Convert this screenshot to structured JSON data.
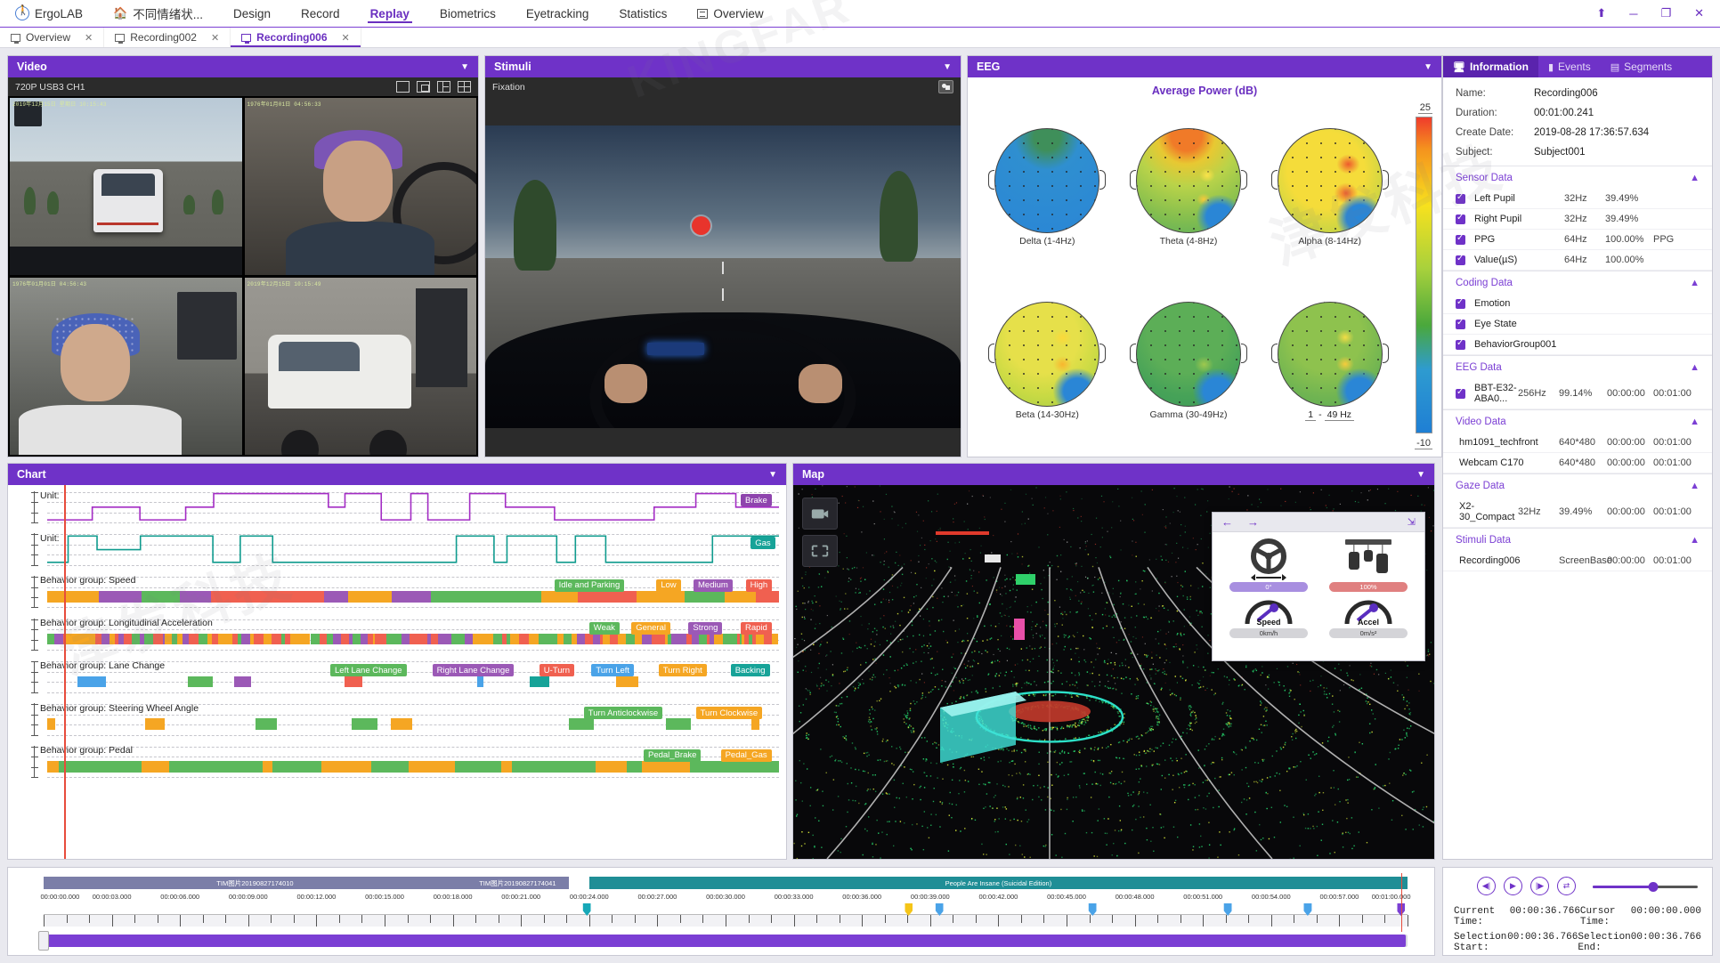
{
  "app": {
    "name": "ErgoLAB",
    "menu": [
      {
        "label": "ErgoLAB",
        "icon": "ergolab-logo"
      },
      {
        "label": "不同情绪状...",
        "icon": "home-icon"
      },
      {
        "label": "Design",
        "icon": ""
      },
      {
        "label": "Record",
        "icon": ""
      },
      {
        "label": "Replay",
        "icon": "",
        "active": true
      },
      {
        "label": "Biometrics",
        "icon": ""
      },
      {
        "label": "Eyetracking",
        "icon": ""
      },
      {
        "label": "Statistics",
        "icon": ""
      },
      {
        "label": "Overview",
        "icon": "overview-icon"
      }
    ],
    "window_controls": [
      "pin",
      "minimize",
      "restore",
      "close"
    ]
  },
  "tabs": [
    {
      "label": "Overview",
      "active": false
    },
    {
      "label": "Recording002",
      "active": false
    },
    {
      "label": "Recording006",
      "active": true
    }
  ],
  "video": {
    "title": "Video",
    "source_label": "720P USB3 CH1",
    "layout_buttons": [
      "single-view",
      "pip-view",
      "split-view",
      "grid-view"
    ],
    "cells": [
      {
        "stamp": "2019年12月15日 星期日 10:15:43"
      },
      {
        "stamp": "1976年01月01日 04:56:33"
      },
      {
        "stamp": "1976年01月01日 04:56:43"
      },
      {
        "stamp": "2019年12月15日 10:15:49"
      }
    ]
  },
  "stimuli": {
    "title": "Stimuli",
    "sub_label": "Fixation",
    "snapshot_button": "snapshot-icon"
  },
  "eeg": {
    "title": "EEG",
    "chart_title": "Average Power (dB)",
    "colorbar_max": "25",
    "colorbar_min": "-10",
    "band_low": "1",
    "band_dash": "-",
    "band_high": "49 Hz",
    "bands": [
      {
        "label": "Delta (1-4Hz)"
      },
      {
        "label": "Theta (4-8Hz)"
      },
      {
        "label": "Alpha (8-14Hz)"
      },
      {
        "label": "Beta (14-30Hz)"
      },
      {
        "label": "Gamma (30-49Hz)"
      }
    ]
  },
  "info": {
    "tabs": [
      {
        "label": "Information",
        "icon": "monitor-icon",
        "active": true
      },
      {
        "label": "Events",
        "icon": "event-icon",
        "active": false
      },
      {
        "label": "Segments",
        "icon": "segments-icon",
        "active": false
      }
    ],
    "fields": [
      {
        "key": "Name:",
        "value": "Recording006"
      },
      {
        "key": "Duration:",
        "value": "00:01:00.241"
      },
      {
        "key": "Create Date:",
        "value": "2019-08-28 17:36:57.634"
      },
      {
        "key": "Subject:",
        "value": "Subject001"
      }
    ],
    "sections": [
      {
        "title": "Sensor Data",
        "rows": [
          {
            "checked": true,
            "name": "Left Pupil",
            "c1": "32Hz",
            "c2": "39.49%",
            "c3": ""
          },
          {
            "checked": true,
            "name": "Right Pupil",
            "c1": "32Hz",
            "c2": "39.49%",
            "c3": ""
          },
          {
            "checked": true,
            "name": "PPG",
            "c1": "64Hz",
            "c2": "100.00%",
            "c3": "PPG"
          },
          {
            "checked": true,
            "name": "Value(µS)",
            "c1": "64Hz",
            "c2": "100.00%",
            "c3": ""
          }
        ]
      },
      {
        "title": "Coding Data",
        "rows": [
          {
            "checked": true,
            "name": "Emotion",
            "c1": "",
            "c2": "",
            "c3": ""
          },
          {
            "checked": true,
            "name": "Eye State",
            "c1": "",
            "c2": "",
            "c3": ""
          },
          {
            "checked": true,
            "name": "BehaviorGroup001",
            "c1": "",
            "c2": "",
            "c3": ""
          }
        ]
      },
      {
        "title": "EEG Data",
        "rows": [
          {
            "checked": true,
            "name": "BBT-E32-ABA0...",
            "c1": "256Hz",
            "c2": "99.14%",
            "c3": "00:00:00",
            "c4": "00:01:00"
          }
        ]
      },
      {
        "title": "Video Data",
        "rows": [
          {
            "checked": null,
            "name": "hm1091_techfront",
            "c1": "640*480",
            "c2": "",
            "c3": "00:00:00",
            "c4": "00:01:00"
          },
          {
            "checked": null,
            "name": "Webcam C170",
            "c1": "640*480",
            "c2": "",
            "c3": "00:00:00",
            "c4": "00:01:00"
          }
        ]
      },
      {
        "title": "Gaze Data",
        "rows": [
          {
            "checked": null,
            "name": "X2-30_Compact",
            "c1": "32Hz",
            "c2": "39.49%",
            "c3": "00:00:00",
            "c4": "00:01:00"
          }
        ]
      },
      {
        "title": "Stimuli Data",
        "rows": [
          {
            "checked": null,
            "name": "Recording006",
            "c1": "ScreenBase",
            "c2": "",
            "c3": "00:00:00",
            "c4": "00:01:00"
          }
        ]
      }
    ]
  },
  "chart": {
    "title": "Chart",
    "rows": [
      {
        "label": "Unit:",
        "type": "line",
        "color": "#a32cc4",
        "tags": [
          {
            "text": "Brake",
            "color": "#8e44ad"
          }
        ]
      },
      {
        "label": "Unit:",
        "type": "line",
        "color": "#0f9b8e",
        "tags": [
          {
            "text": "Gas",
            "color": "#17a398"
          }
        ]
      },
      {
        "label": "Behavior group: Speed",
        "type": "band",
        "tags": [
          {
            "text": "Idle and Parking",
            "color": "#5cb85c"
          },
          {
            "text": "Low",
            "color": "#f5a623"
          },
          {
            "text": "Medium",
            "color": "#9b59b6"
          },
          {
            "text": "High",
            "color": "#f06050"
          }
        ]
      },
      {
        "label": "Behavior group: Longitudinal Acceleration",
        "type": "band",
        "tags": [
          {
            "text": "Weak",
            "color": "#5cb85c"
          },
          {
            "text": "General",
            "color": "#f5a623"
          },
          {
            "text": "Strong",
            "color": "#9b59b6"
          },
          {
            "text": "Rapid",
            "color": "#f06050"
          }
        ]
      },
      {
        "label": "Behavior group: Lane Change",
        "type": "band",
        "tags": [
          {
            "text": "Left Lane Change",
            "color": "#5cb85c"
          },
          {
            "text": "Right Lane Change",
            "color": "#9b59b6"
          },
          {
            "text": "U-Turn",
            "color": "#f06050"
          },
          {
            "text": "Turn Left",
            "color": "#4aa3e8"
          },
          {
            "text": "Turn Right",
            "color": "#f5a623"
          },
          {
            "text": "Backing",
            "color": "#17a398"
          }
        ]
      },
      {
        "label": "Behavior group: Steering Wheel Angle",
        "type": "band",
        "tags": [
          {
            "text": "Turn Anticlockwise",
            "color": "#5cb85c"
          },
          {
            "text": "Turn Clockwise",
            "color": "#f5a623"
          }
        ]
      },
      {
        "label": "Behavior group: Pedal",
        "type": "band",
        "tags": [
          {
            "text": "Pedal_Brake",
            "color": "#5cb85c"
          },
          {
            "text": "Pedal_Gas",
            "color": "#f5a623"
          }
        ]
      }
    ]
  },
  "map": {
    "title": "Map",
    "tools": [
      "camera-icon",
      "fit-icon"
    ],
    "overlay": {
      "back_icon": "arrow-left-icon",
      "forward_icon": "arrow-right-icon",
      "expand_icon": "expand-icon",
      "steering": {
        "icon": "steering-wheel-icon",
        "value": "0°"
      },
      "pedals": {
        "icon": "pedals-icon",
        "value": "100%"
      },
      "speed": {
        "icon": "gauge-icon",
        "label": "Speed",
        "value": "0km/h"
      },
      "accel": {
        "icon": "gauge-icon",
        "label": "Accel",
        "value": "0m/s²"
      }
    }
  },
  "timeline": {
    "segments": [
      {
        "label": "TIM图片20190827174010",
        "color": "#7b7ea8",
        "start": 0,
        "width": 31
      },
      {
        "label": "TIM图片20190827174041",
        "color": "#7b7ea8",
        "start": 31,
        "width": 7.5
      },
      {
        "label": "People Are Insane (Suicidal Edition)",
        "color": "#1f8e96",
        "start": 40,
        "width": 60
      }
    ],
    "ticks": [
      "00:00:00.000",
      "00:00:03.000",
      "00:00:06.000",
      "00:00:09.000",
      "00:00:12.000",
      "00:00:15.000",
      "00:00:18.000",
      "00:00:21.000",
      "00:00:24.000",
      "00:00:27.000",
      "00:00:30.000",
      "00:00:33.000",
      "00:00:36.000",
      "00:00:39.000",
      "00:00:42.000",
      "00:00:45.000",
      "00:00:48.000",
      "00:00:51.000",
      "00:00:54.000",
      "00:00:57.000",
      "00:01:00.000"
    ],
    "markers": [
      {
        "pos": 24.5,
        "color": "#17a8b8"
      },
      {
        "pos": 39.0,
        "color": "#f5c518"
      },
      {
        "pos": 40.4,
        "color": "#4aa3e8"
      },
      {
        "pos": 47.3,
        "color": "#4aa3e8"
      },
      {
        "pos": 53.4,
        "color": "#4aa3e8"
      },
      {
        "pos": 57.0,
        "color": "#4aa3e8"
      },
      {
        "pos": 61.2,
        "color": "#7b3fd4"
      }
    ],
    "cursor_pos": 61.2
  },
  "playback": {
    "buttons": [
      "step-back-icon",
      "play-icon",
      "step-forward-icon",
      "loop-icon"
    ],
    "speed_value": 58,
    "times": [
      {
        "lk": "Current Time:",
        "lv": "00:00:36.766",
        "rk": "Cursor Time:",
        "rv": "00:00:00.000"
      },
      {
        "lk": "Selection Start:",
        "lv": "00:00:36.766",
        "rk": "Selection End:",
        "rv": "00:00:36.766"
      }
    ]
  },
  "colors": {
    "accent": "#6f32c8",
    "header": "#6f32c8",
    "cursor": "#e74c3c"
  }
}
